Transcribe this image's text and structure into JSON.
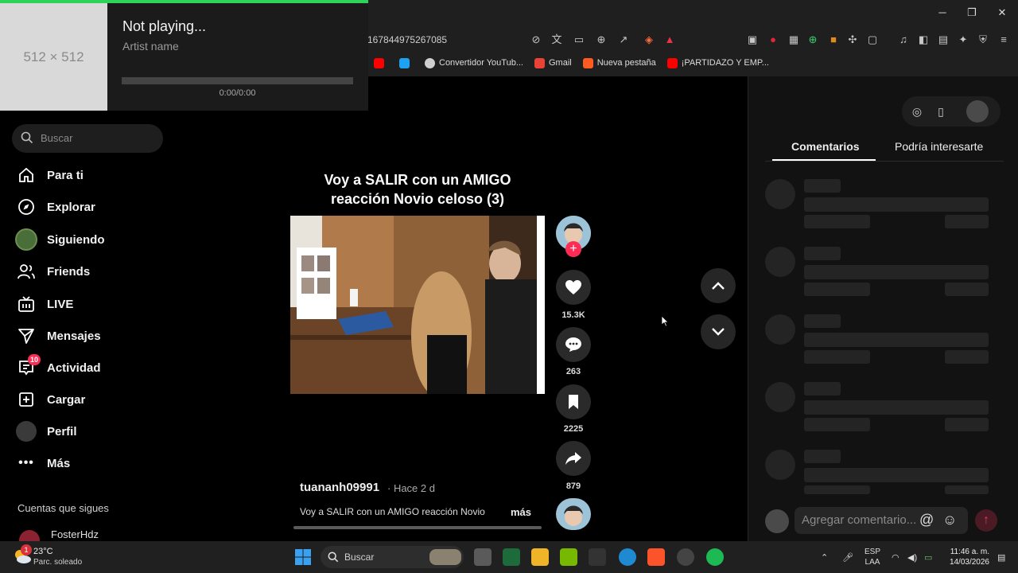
{
  "browser": {
    "url": "167844975267085",
    "bookmarks": [
      {
        "label": "",
        "color": "#ff0000"
      },
      {
        "label": "",
        "color": "#1da1f2"
      },
      {
        "label": "Convertidor YouTub...",
        "color": "#dddddd"
      },
      {
        "label": "Gmail",
        "color": "#ea4335"
      },
      {
        "label": "Nueva pestaña",
        "color": "#ff5a1f"
      },
      {
        "label": "¡PARTIDAZO Y EMP...",
        "color": "#ff0000"
      }
    ]
  },
  "mini_player": {
    "art_placeholder": "512 × 512",
    "title": "Not playing...",
    "artist": "Artist name",
    "time": "0:00/0:00",
    "progress": 0
  },
  "sidebar": {
    "search_placeholder": "Buscar",
    "items": [
      {
        "label": "Para ti",
        "icon": "home-icon"
      },
      {
        "label": "Explorar",
        "icon": "compass-icon"
      },
      {
        "label": "Siguiendo",
        "icon": "following-avatar"
      },
      {
        "label": "Friends",
        "icon": "friends-icon"
      },
      {
        "label": "LIVE",
        "icon": "live-icon"
      },
      {
        "label": "Mensajes",
        "icon": "send-icon"
      },
      {
        "label": "Actividad",
        "icon": "inbox-icon",
        "badge": "10"
      },
      {
        "label": "Cargar",
        "icon": "upload-icon"
      },
      {
        "label": "Perfil",
        "icon": "profile-avatar"
      },
      {
        "label": "Más",
        "icon": "more-icon"
      }
    ],
    "following_title": "Cuentas que sigues",
    "following": [
      {
        "name": "FosterHdz"
      }
    ]
  },
  "video": {
    "title_line1": "Voy a SALIR con un AMIGO",
    "title_line2": "reacción Novio celoso (3)",
    "author": "tuananh09991",
    "posted": "· Hace 2 d",
    "description": "Voy a SALIR con un AMIGO reacción Novio",
    "more": "más",
    "progress": 0.02
  },
  "actions": {
    "likes": "15.3K",
    "comments": "263",
    "saves": "2225",
    "shares": "879"
  },
  "panel": {
    "tabs": [
      "Comentarios",
      "Podría interesarte"
    ],
    "active_tab": "Comentarios",
    "comment_placeholder": "Agregar comentario..."
  },
  "taskbar": {
    "weather_temp": "23°C",
    "weather_desc": "Parc. soleado",
    "weather_badge": "1",
    "search_placeholder": "Buscar",
    "lang_top": "ESP",
    "lang_bottom": "LAA",
    "time": "11:46 a. m.",
    "date": "14/03/2026"
  },
  "colors": {
    "accent_green": "#2fd35a",
    "tiktok_red": "#fe2c55"
  }
}
